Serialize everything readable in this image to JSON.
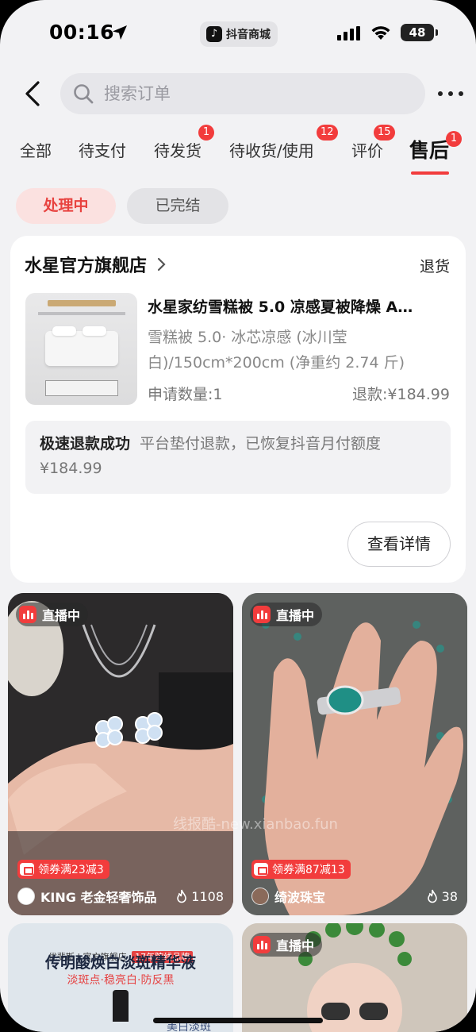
{
  "status_bar": {
    "time": "00:16",
    "app_name": "抖音商城",
    "battery": "48"
  },
  "header": {
    "search_placeholder": "搜索订单"
  },
  "tabs": [
    {
      "label": "全部",
      "badge": ""
    },
    {
      "label": "待支付",
      "badge": ""
    },
    {
      "label": "待发货",
      "badge": "1"
    },
    {
      "label": "待收货/使用",
      "badge": "12"
    },
    {
      "label": "评价",
      "badge": "15"
    },
    {
      "label": "售后",
      "badge": "1",
      "active": true
    }
  ],
  "filters": {
    "active": "处理中",
    "other": "已完结"
  },
  "order": {
    "store_name": "水星官方旗舰店",
    "order_type": "退货",
    "product_title": "水星家纺雪糕被 5.0 凉感夏被降燥 A…",
    "product_spec": "雪糕被 5.0· 冰芯凉感 (冰川莹白)/150cm*200cm (净重约 2.74 斤)",
    "quantity": "申请数量:1",
    "refund": "退款:¥184.99",
    "notice_title": "极速退款成功",
    "notice_text": "平台垫付退款，已恢复抖音月付额度 ¥184.99",
    "detail_button": "查看详情"
  },
  "feed": [
    {
      "live_label": "直播中",
      "coupon": "领券满23减3",
      "shop": "KING 老金轻奢饰品",
      "count": "1108"
    },
    {
      "live_label": "直播中",
      "coupon": "领券满87减13",
      "shop": "绮波珠宝",
      "count": "38"
    },
    {
      "brand_line": "优斐斯 | 官方旗舰店",
      "tag": "17年院线品牌",
      "headline": "传明酸焕白淡斑精华液",
      "subline": "淡斑点·稳亮白·防反黑",
      "bottom_text": "美白淡斑"
    },
    {
      "live_label": "直播中"
    }
  ],
  "watermark": "线报酷-new.xianbao.fun",
  "colors": {
    "accent": "#f23c3c",
    "chip_active_bg": "#fbe1e0",
    "page_bg": "#f2f2f4"
  }
}
